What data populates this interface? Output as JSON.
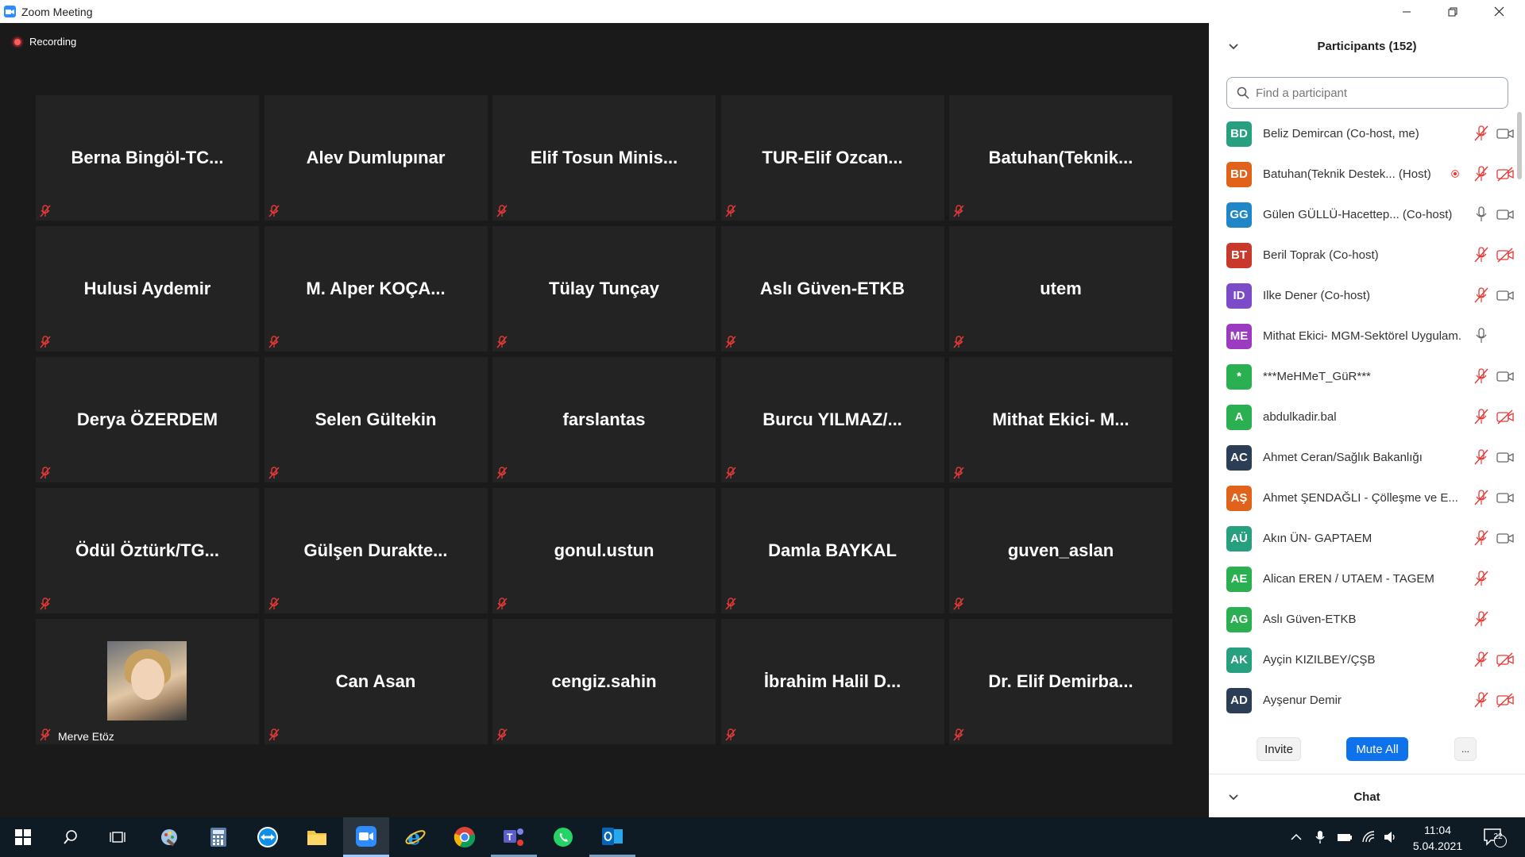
{
  "window": {
    "title": "Zoom Meeting"
  },
  "recording": {
    "label": "Recording"
  },
  "gallery": [
    {
      "name": "Berna  Bingöl-TC..."
    },
    {
      "name": "Alev Dumlupınar"
    },
    {
      "name": "Elif  Tosun  Minis..."
    },
    {
      "name": "TUR-Elif  Ozcan..."
    },
    {
      "name": "Batuhan(Teknik..."
    },
    {
      "name": "Hulusi Aydemir"
    },
    {
      "name": "M.  Alper  KOÇA..."
    },
    {
      "name": "Tülay Tunçay"
    },
    {
      "name": "Aslı Güven-ETKB"
    },
    {
      "name": "utem"
    },
    {
      "name": "Derya ÖZERDEM"
    },
    {
      "name": "Selen Gültekin"
    },
    {
      "name": "farslantas"
    },
    {
      "name": "Burcu  YILMAZ/..."
    },
    {
      "name": "Mithat  Ekici-  M..."
    },
    {
      "name": "Ödül  Öztürk/TG..."
    },
    {
      "name": "Gülşen  Durakte..."
    },
    {
      "name": "gonul.ustun"
    },
    {
      "name": "Damla BAYKAL"
    },
    {
      "name": "guven_aslan"
    },
    {
      "name": "Merve Etöz",
      "has_photo": true
    },
    {
      "name": "Can Asan"
    },
    {
      "name": "cengiz.sahin"
    },
    {
      "name": "İbrahim  Halil  D..."
    },
    {
      "name": "Dr.  Elif  Demirba..."
    }
  ],
  "participants_panel": {
    "title": "Participants (152)",
    "search_placeholder": "Find a participant",
    "list": [
      {
        "initials": "BD",
        "color": "#27a07f",
        "name": "Beliz Demircan (Co-host, me)",
        "icons": [
          "mic-muted-icon",
          "video-icon"
        ]
      },
      {
        "initials": "BD",
        "color": "#e0621b",
        "name": "Batuhan(Teknik Destek... (Host)",
        "icons": [
          "record-icon",
          "mic-muted-icon",
          "video-off-icon"
        ]
      },
      {
        "initials": "GG",
        "color": "#1f86c8",
        "name": "Gülen GÜLLÜ-Hacettep... (Co-host)",
        "icons": [
          "mic-icon",
          "video-icon"
        ]
      },
      {
        "initials": "BT",
        "color": "#c8392b",
        "name": "Beril Toprak (Co-host)",
        "icons": [
          "mic-muted-icon",
          "video-off-icon"
        ]
      },
      {
        "initials": "ID",
        "color": "#7b4bc8",
        "name": "Ilke Dener (Co-host)",
        "icons": [
          "mic-muted-icon",
          "video-icon"
        ]
      },
      {
        "initials": "ME",
        "color": "#9b3bc0",
        "name": "Mithat Ekici- MGM-Sektörel Uygulam...",
        "icons": [
          "mic-icon"
        ]
      },
      {
        "initials": "*",
        "color": "#2ab050",
        "name": "***MeHMeT_GüR***",
        "icons": [
          "mic-muted-icon",
          "video-icon"
        ]
      },
      {
        "initials": "A",
        "color": "#2ab050",
        "name": "abdulkadir.bal",
        "icons": [
          "mic-muted-icon",
          "video-off-icon"
        ]
      },
      {
        "initials": "AC",
        "color": "#2c3e55",
        "name": "Ahmet Ceran/Sağlık Bakanlığı",
        "icons": [
          "mic-muted-icon",
          "video-icon"
        ]
      },
      {
        "initials": "AŞ",
        "color": "#e0621b",
        "name": "Ahmet ŞENDAĞLI - Çölleşme ve E...",
        "icons": [
          "mic-muted-icon",
          "video-icon"
        ]
      },
      {
        "initials": "AÜ",
        "color": "#27a07f",
        "name": "Akın ÜN- GAPTAEM",
        "icons": [
          "mic-muted-icon",
          "video-icon"
        ]
      },
      {
        "initials": "AE",
        "color": "#2ab050",
        "name": "Alican EREN / UTAEM - TAGEM",
        "icons": [
          "mic-muted-icon"
        ]
      },
      {
        "initials": "AG",
        "color": "#2ab050",
        "name": "Aslı Güven-ETKB",
        "icons": [
          "mic-muted-icon"
        ]
      },
      {
        "initials": "AK",
        "color": "#27a07f",
        "name": "Ayçin KIZILBEY/ÇŞB",
        "icons": [
          "mic-muted-icon",
          "video-off-icon"
        ]
      },
      {
        "initials": "AD",
        "color": "#2c3e55",
        "name": "Ayşenur Demir",
        "icons": [
          "mic-muted-icon",
          "video-off-icon"
        ]
      }
    ],
    "invite_label": "Invite",
    "mute_all_label": "Mute All",
    "more_label": "...",
    "chat_label": "Chat"
  },
  "taskbar": {
    "time": "11:04",
    "date": "5.04.2021",
    "notifications": "22",
    "apps": [
      "start-icon",
      "search-icon",
      "task-view-icon",
      "paint-icon",
      "calculator-icon",
      "teamviewer-icon",
      "file-explorer-icon",
      "zoom-icon",
      "internet-explorer-icon",
      "chrome-icon",
      "teams-icon",
      "whatsapp-icon",
      "outlook-icon"
    ]
  },
  "colors": {
    "accent": "#0e72ed",
    "muted_red": "#e53935",
    "stage_bg": "#1a1a1a",
    "tile_bg": "#232323"
  }
}
